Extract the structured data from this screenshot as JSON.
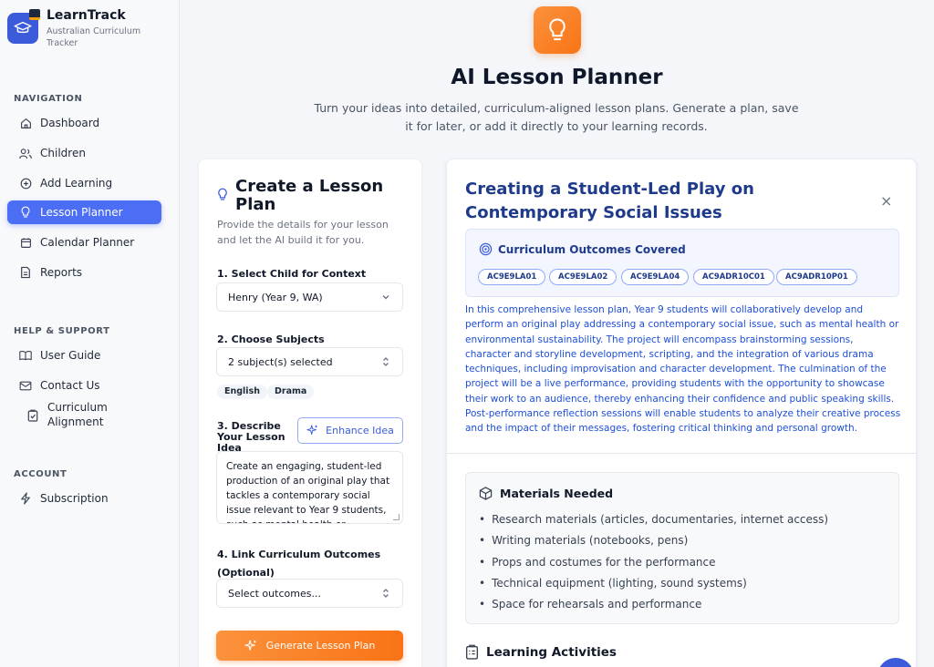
{
  "brand": {
    "name": "LearnTrack",
    "subtitle": "Australian Curriculum Tracker"
  },
  "nav": {
    "navigation_label": "NAVIGATION",
    "items": [
      {
        "label": "Dashboard",
        "icon": "home-icon"
      },
      {
        "label": "Children",
        "icon": "users-icon"
      },
      {
        "label": "Add Learning",
        "icon": "plus-circle-icon"
      },
      {
        "label": "Lesson Planner",
        "icon": "lightbulb-icon",
        "active": true
      },
      {
        "label": "Calendar Planner",
        "icon": "calendar-icon"
      },
      {
        "label": "Reports",
        "icon": "file-icon"
      }
    ],
    "help_label": "HELP & SUPPORT",
    "help_items": [
      {
        "label": "User Guide",
        "icon": "book-icon"
      },
      {
        "label": "Contact Us",
        "icon": "mail-icon"
      },
      {
        "label": "Curriculum Alignment",
        "icon": "clipboard-check-icon"
      }
    ],
    "account_label": "ACCOUNT",
    "account_items": [
      {
        "label": "Subscription",
        "icon": "zap-icon"
      }
    ]
  },
  "header": {
    "title": "AI Lesson Planner",
    "subtitle": "Turn your ideas into detailed, curriculum-aligned lesson plans. Generate a plan, save it for later, or add it directly to your learning records."
  },
  "form": {
    "title": "Create a Lesson Plan",
    "description": "Provide the details for your lesson and let the AI build it for you.",
    "child_label": "1. Select Child for Context",
    "child_value": "Henry (Year 9, WA)",
    "subjects_label": "2. Choose Subjects",
    "subjects_value": "2 subject(s) selected",
    "subjects": [
      "English",
      "Drama"
    ],
    "idea_label": "3. Describe Your Lesson Idea",
    "enhance_label": "Enhance Idea",
    "idea_text": "Create an engaging, student-led production of an original play that tackles a contemporary social issue relevant to Year 9 students, such as mental health or environmental",
    "outcomes_label": "4. Link Curriculum Outcomes (Optional)",
    "outcomes_value": "Select outcomes...",
    "generate_label": "Generate Lesson Plan"
  },
  "plan": {
    "title": "Creating a Student-Led Play on Contemporary Social Issues",
    "close_glyph": "×",
    "outcomes_heading": "Curriculum Outcomes Covered",
    "outcome_codes": [
      "AC9E9LA01",
      "AC9E9LA02",
      "AC9E9LA04",
      "AC9ADR10C01",
      "AC9ADR10P01"
    ],
    "summary": "In this comprehensive lesson plan, Year 9 students will collaboratively develop and perform an original play addressing a contemporary social issue, such as mental health or environmental sustainability. The project will encompass brainstorming sessions, character and storyline development, scripting, and the integration of various drama techniques, including improvisation and character development. The culmination of the project will be a live performance, providing students with the opportunity to showcase their work to an audience, thereby enhancing their confidence and public speaking skills. Post-performance reflection sessions will enable students to analyze their creative process and the impact of their messages, fostering critical thinking and personal growth.",
    "materials_heading": "Materials Needed",
    "materials": [
      "Research materials (articles, documentaries, internet access)",
      "Writing materials (notebooks, pens)",
      "Props and costumes for the performance",
      "Technical equipment (lighting, sound systems)",
      "Space for rehearsals and performance"
    ],
    "activities_heading": "Learning Activities"
  },
  "colors": {
    "accent": "#4c6ef5",
    "orange": "#f97316",
    "plan_title": "#1e3a8a"
  }
}
